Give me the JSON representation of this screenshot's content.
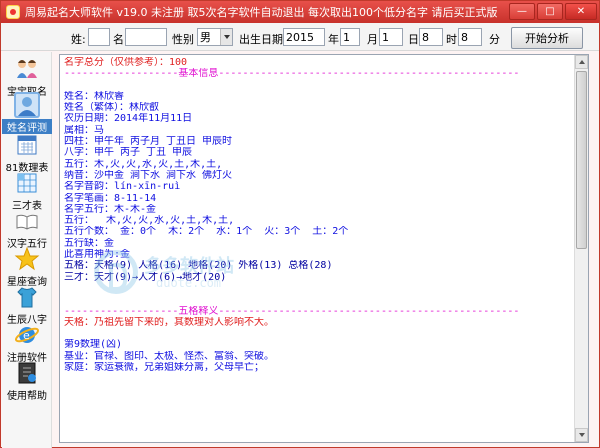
{
  "window": {
    "title": "周易起名大师软件 v19.0  未注册  取5次名字软件自动退出 每次取出100个低分名字 请后买正式版",
    "minimize": "—",
    "maximize": "□",
    "close": "✕"
  },
  "form": {
    "surname_label": "姓:",
    "surname_value": "",
    "name_label": "名",
    "name_value": "",
    "gender_label": "性别",
    "gender_value": "男",
    "birth_label": "出生日期:",
    "year_value": "2015",
    "year_unit": "年",
    "month_value": "1",
    "month_unit": "月",
    "day_value": "1",
    "day_unit": "日",
    "hour_value": "8",
    "hour_unit": "时",
    "minute_value": "8",
    "minute_unit": "分",
    "analyze_button": "开始分析"
  },
  "sidebar": {
    "items": [
      {
        "label": "宝宝取名",
        "icon": "family-icon"
      },
      {
        "label": "姓名评测",
        "icon": "avatar-icon"
      },
      {
        "label": "81数理表",
        "icon": "calendar-icon"
      },
      {
        "label": "三才表",
        "icon": "grid-icon"
      },
      {
        "label": "汉字五行",
        "icon": "book-icon"
      },
      {
        "label": "星座查询",
        "icon": "star-icon"
      },
      {
        "label": "生辰八字",
        "icon": "shirt-icon"
      },
      {
        "label": "注册软件",
        "icon": "internet-icon"
      },
      {
        "label": "使用帮助",
        "icon": "help-icon"
      }
    ],
    "active_index": 1
  },
  "content": {
    "lines": [
      {
        "text": "名字总分（仅供参考）：100",
        "color": "red"
      },
      {
        "text": "-------------------基本信息--------------------------------------------------",
        "color": "magenta"
      },
      {
        "text": "",
        "color": "blue"
      },
      {
        "text": "姓名：林欣睿",
        "color": "blue"
      },
      {
        "text": "姓名（繁体）：林欣叡",
        "color": "blue"
      },
      {
        "text": "农历日期：2014年11月11日",
        "color": "blue"
      },
      {
        "text": "属相：马",
        "color": "blue"
      },
      {
        "text": "四柱：甲午年 丙子月 丁丑日 甲辰时",
        "color": "blue"
      },
      {
        "text": "八字：甲午 丙子 丁丑 甲辰",
        "color": "blue"
      },
      {
        "text": "五行：木,火,火,水,火,土,木,土,",
        "color": "blue"
      },
      {
        "text": "纳音：沙中金 涧下水 涧下水 佛灯火",
        "color": "blue"
      },
      {
        "text": "名字音韵：lín-xīn-ruì",
        "color": "blue"
      },
      {
        "text": "名字笔画：8-11-14",
        "color": "blue"
      },
      {
        "text": "名字五行：木-木-金",
        "color": "blue"
      },
      {
        "text": "五行：  木,火,火,水,火,土,木,土,",
        "color": "blue"
      },
      {
        "text": "五行个数： 金：0个  木：2个  水：1个  火：3个  土：2个",
        "color": "blue"
      },
      {
        "text": "五行缺：金",
        "color": "blue"
      },
      {
        "text": "此喜用神为:金",
        "color": "blue"
      },
      {
        "text": "五格：天格(9) 人格(16) 地格(20) 外格(13) 总格(28)",
        "color": "navy"
      },
      {
        "text": "三才：天才(9)→人才(6)→地才(20)",
        "color": "navy"
      },
      {
        "text": "",
        "color": "blue"
      },
      {
        "text": "",
        "color": "blue"
      },
      {
        "text": "-------------------五格释义--------------------------------------------------",
        "color": "magenta"
      },
      {
        "text": "天格：乃祖先留下来的，其数理对人影响不大。",
        "color": "red"
      },
      {
        "text": "",
        "color": "blue"
      },
      {
        "text": "第9数理(凶)",
        "color": "blue"
      },
      {
        "text": "基业：官禄、图印、太极、怪杰、富翁、突破。",
        "color": "blue"
      },
      {
        "text": "家庭：家运衰微，兄弟姐妹分离，父母早亡；",
        "color": "blue"
      }
    ]
  },
  "watermark": {
    "name": "多多软件站",
    "url": "duote.com"
  },
  "colors": {
    "titlebar": "#d83d36",
    "red_text": "#e02020",
    "magenta_text": "#e010d0",
    "blue_text": "#1010e0",
    "active_sidebar": "#3d7fc6"
  }
}
